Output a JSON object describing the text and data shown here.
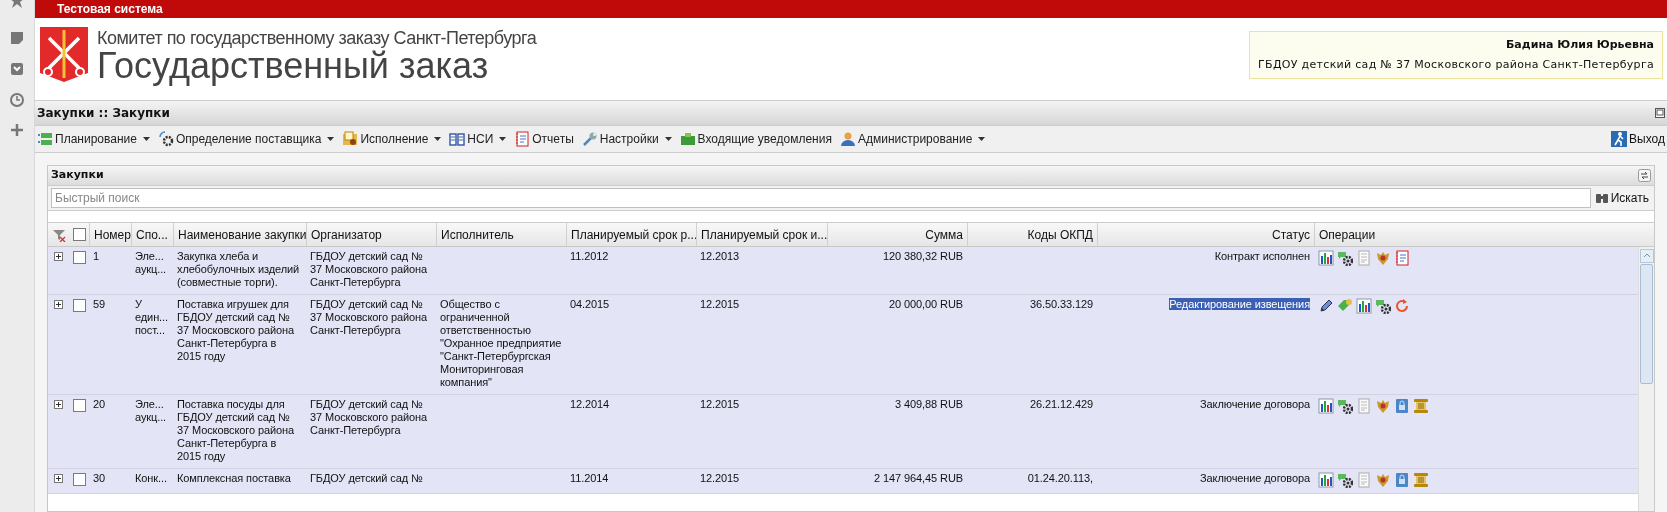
{
  "top_bar": {
    "title": "Тестовая система"
  },
  "header": {
    "subtitle": "Комитет по государственному заказу Санкт-Петербурга",
    "title": "Государственный заказ"
  },
  "user": {
    "name": "Бадина Юлия Юрьевна",
    "organization": "ГБДОУ детский сад № 37 Московского района Санкт-Петербурга"
  },
  "breadcrumb": "Закупки :: Закупки",
  "menu": [
    {
      "label": "Планирование",
      "kind": "list",
      "dropdown": true
    },
    {
      "label": "Определение поставщика",
      "kind": "gears",
      "dropdown": true
    },
    {
      "label": "Исполнение",
      "kind": "folder",
      "dropdown": true
    },
    {
      "label": "НСИ",
      "kind": "book",
      "dropdown": true
    },
    {
      "label": "Отчеты",
      "kind": "notebook",
      "dropdown": false
    },
    {
      "label": "Настройки",
      "kind": "wrench",
      "dropdown": true
    },
    {
      "label": "Входящие уведомления",
      "kind": "inbox",
      "dropdown": false
    },
    {
      "label": "Администрирование",
      "kind": "user",
      "dropdown": true
    }
  ],
  "exit_label": "Выход",
  "panel": {
    "title": "Закупки",
    "search": {
      "placeholder": "Быстрый поиск",
      "button": "Искать"
    }
  },
  "table": {
    "all_checked": false,
    "columns": [
      "Номер",
      "Спо...",
      "Наименование закупки",
      "Организатор",
      "Исполнитель",
      "Планируемый срок р...",
      "Планируемый срок и...",
      "Сумма",
      "Коды ОКПД",
      "Статус",
      "Операции"
    ],
    "rows": [
      {
        "checked": false,
        "number": "1",
        "method": "Эле... аукц...",
        "name": "Закупка хлеба и хлебобулочных изделий (совместные торги).",
        "organizer": "ГБДОУ детский сад № 37 Московского района Санкт-Петербурга",
        "executor": "",
        "date_1": "11.2012",
        "date_2": "12.2013",
        "sum": "120 380,32 RUB",
        "okpd": "",
        "status": "Контракт исполнен",
        "status_highlighted": false,
        "operations": [
          {
            "kind": "chart"
          },
          {
            "kind": "gear"
          },
          {
            "kind": "document"
          },
          {
            "kind": "emblem"
          },
          {
            "kind": "notebook"
          }
        ]
      },
      {
        "checked": false,
        "number": "59",
        "method": "У един... пост...",
        "name": "Поставка игрушек для ГБДОУ детский сад № 37 Московского района Санкт-Петербурга в 2015 году",
        "organizer": "ГБДОУ детский сад № 37 Московского района Санкт-Петербурга",
        "executor": "Общество с ограниченной ответственностью \"Охранное предприятие \"Санкт-Петербургская Мониторинговая компания\"",
        "date_1": "04.2015",
        "date_2": "12.2015",
        "sum": "20 000,00 RUB",
        "okpd": "36.50.33.129",
        "status": "Редактирование извещения",
        "status_highlighted": true,
        "operations": [
          {
            "kind": "pencil"
          },
          {
            "kind": "tag"
          },
          {
            "kind": "chart"
          },
          {
            "kind": "gear"
          },
          {
            "kind": "refresh"
          }
        ]
      },
      {
        "checked": false,
        "number": "20",
        "method": "Эле... аукц...",
        "name": "Поставка посуды для ГБДОУ детский сад № 37 Московского района Санкт-Петербурга в 2015 году",
        "organizer": "ГБДОУ детский сад № 37 Московского района Санкт-Петербурга",
        "executor": "",
        "date_1": "12.2014",
        "date_2": "12.2015",
        "sum": "3 409,88 RUB",
        "okpd": "26.21.12.429",
        "status": "Заключение договора",
        "status_highlighted": false,
        "operations": [
          {
            "kind": "chart"
          },
          {
            "kind": "gear"
          },
          {
            "kind": "document"
          },
          {
            "kind": "emblem"
          },
          {
            "kind": "lock"
          },
          {
            "kind": "scroll"
          }
        ]
      },
      {
        "checked": false,
        "number": "30",
        "method": "Конк...",
        "name": "Комплексная поставка",
        "organizer": "ГБДОУ детский сад №",
        "executor": "",
        "date_1": "11.2014",
        "date_2": "12.2015",
        "sum": "2 147 964,45 RUB",
        "okpd": "01.24.20.113,",
        "status": "Заключение договора",
        "status_highlighted": false,
        "operations": [
          {
            "kind": "chart"
          },
          {
            "kind": "gear"
          },
          {
            "kind": "document"
          },
          {
            "kind": "emblem"
          },
          {
            "kind": "lock"
          },
          {
            "kind": "scroll"
          }
        ]
      }
    ]
  }
}
